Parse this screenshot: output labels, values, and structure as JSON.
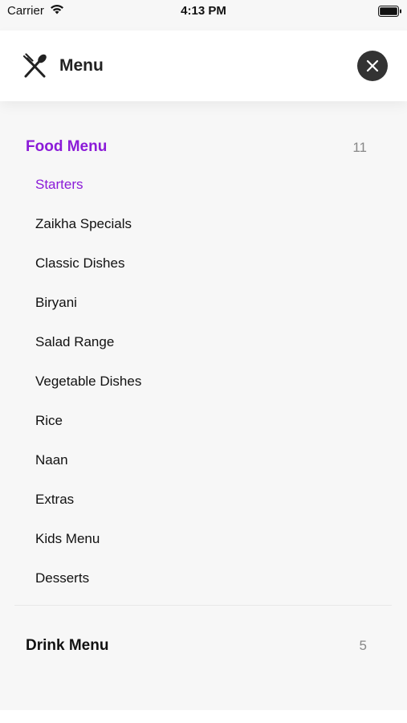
{
  "status_bar": {
    "carrier": "Carrier",
    "time": "4:13 PM"
  },
  "header": {
    "title": "Menu",
    "logo_icon": "fork-spoon-icon",
    "close_icon": "close-icon"
  },
  "food_menu": {
    "title": "Food Menu",
    "count": "11",
    "items": [
      "Starters",
      "Zaikha Specials",
      "Classic Dishes",
      "Biryani",
      "Salad Range",
      "Vegetable Dishes",
      "Rice",
      "Naan",
      "Extras",
      "Kids Menu",
      "Desserts"
    ],
    "active_item": "Starters"
  },
  "drink_menu": {
    "title": "Drink Menu",
    "count": "5"
  },
  "colors": {
    "accent": "#8b1bd8",
    "text": "#111111",
    "count": "#888888",
    "close_bg": "#333333"
  }
}
